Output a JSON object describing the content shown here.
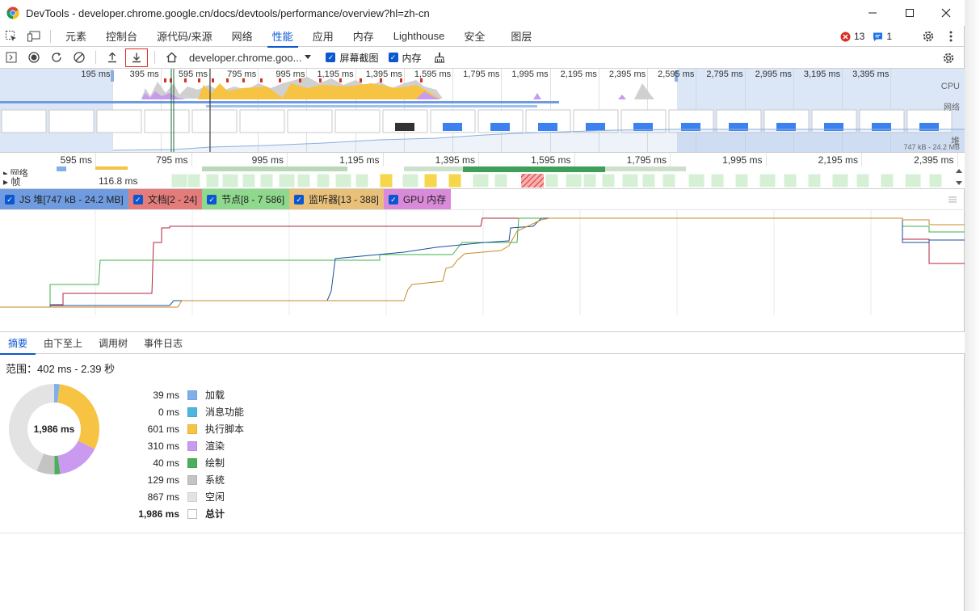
{
  "window": {
    "title": "DevTools - developer.chrome.google.cn/docs/devtools/performance/overview?hl=zh-cn"
  },
  "tabs": [
    {
      "label": "元素"
    },
    {
      "label": "控制台"
    },
    {
      "label": "源代码/来源"
    },
    {
      "label": "网络"
    },
    {
      "label": "性能",
      "active": true
    },
    {
      "label": "应用"
    },
    {
      "label": "内存"
    },
    {
      "label": "Lighthouse"
    },
    {
      "label": "安全"
    },
    {
      "label": "图层"
    }
  ],
  "badges": {
    "errors": "13",
    "messages": "1"
  },
  "perf_toolbar": {
    "url_select": "developer.chrome.goo...",
    "screenshots_label": "屏幕截图",
    "memory_label": "内存"
  },
  "overview": {
    "ticks": [
      "195 ms",
      "395 ms",
      "595 ms",
      "795 ms",
      "995 ms",
      "1,195 ms",
      "1,395 ms",
      "1,595 ms",
      "1,795 ms",
      "1,995 ms",
      "2,195 ms",
      "2,395 ms",
      "2,595 ms",
      "2,795 ms",
      "2,995 ms",
      "3,195 ms",
      "3,395 ms"
    ],
    "cpu_label": "CPU",
    "net_label": "网络",
    "heap_label": "堆",
    "heap_range": "747 kB - 24.2 MB"
  },
  "ruler": {
    "ticks": [
      "595 ms",
      "795 ms",
      "995 ms",
      "1,195 ms",
      "1,395 ms",
      "1,595 ms",
      "1,795 ms",
      "1,995 ms",
      "2,195 ms",
      "2,395 ms"
    ]
  },
  "tracks": {
    "network_label": "网络",
    "frames_label": "帧",
    "frame_time": "116.8 ms"
  },
  "memory_counters": [
    {
      "label": "JS 堆[747 kB - 24.2 MB]",
      "color": "#6f9ce0"
    },
    {
      "label": "文档[2 - 24]",
      "color": "#e47c7c"
    },
    {
      "label": "节点[8 - 7 586]",
      "color": "#8fd98f"
    },
    {
      "label": "监听器[13 - 388]",
      "color": "#e8c07a"
    },
    {
      "label": "GPU 内存",
      "color": "#d98ad9"
    }
  ],
  "bottom_tabs": [
    {
      "label": "摘要",
      "active": true
    },
    {
      "label": "由下至上"
    },
    {
      "label": "调用树"
    },
    {
      "label": "事件日志"
    }
  ],
  "summary": {
    "range": "范围：402 ms - 2.39 秒",
    "total_center": "1,986 ms",
    "rows": [
      {
        "value": "39 ms",
        "label": "加载",
        "color": "#7fb0ec",
        "ms": 39
      },
      {
        "value": "0 ms",
        "label": "消息功能",
        "color": "#4db6e0",
        "ms": 0
      },
      {
        "value": "601 ms",
        "label": "执行脚本",
        "color": "#f6c343",
        "ms": 601
      },
      {
        "value": "310 ms",
        "label": "渲染",
        "color": "#c99af0",
        "ms": 310
      },
      {
        "value": "40 ms",
        "label": "绘制",
        "color": "#4caf5b",
        "ms": 40
      },
      {
        "value": "129 ms",
        "label": "系统",
        "color": "#c4c4c4",
        "ms": 129
      },
      {
        "value": "867 ms",
        "label": "空闲",
        "color": "#e3e3e3",
        "ms": 867
      }
    ],
    "total": {
      "value": "1,986 ms",
      "label": "总计"
    }
  }
}
